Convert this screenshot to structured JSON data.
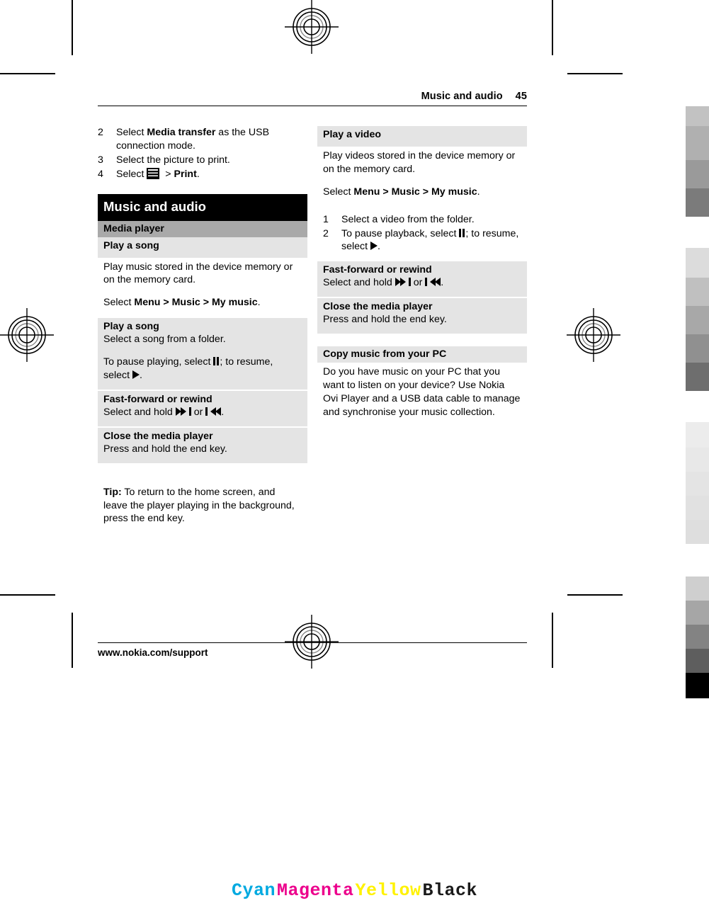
{
  "running_head": {
    "title": "Music and audio",
    "page_number": "45"
  },
  "left_column": {
    "steps": [
      {
        "num": "2",
        "pre": "Select ",
        "bold": "Media transfer",
        "post": " as the USB connection mode."
      },
      {
        "num": "3",
        "pre": "Select the picture to print.",
        "bold": "",
        "post": ""
      },
      {
        "num": "4",
        "pre": "Select ",
        "bold": "",
        "post": ""
      }
    ],
    "step4_suffix_sep": "> ",
    "step4_bold": "Print",
    "step4_end": ".",
    "chapter_title": "Music and audio",
    "section_title": "Media player",
    "intro_task_title": "Play a song",
    "intro_paragraph": "Play music stored in the device memory or on the memory card.",
    "intro_path": {
      "lead": "Select ",
      "b1": "Menu",
      "sep1": " > ",
      "b2": "Music",
      "sep2": " > ",
      "b3": "My music",
      "end": "."
    },
    "tasks": [
      {
        "title": "Play a song",
        "line1": "Select a song from a folder.",
        "line2_a": "To pause playing, select ",
        "line2_icon": "pause-icon",
        "line2_b": "; to resume, select ",
        "line2_icon2": "play-icon",
        "line2_c": "."
      },
      {
        "title": "Fast-forward or rewind",
        "line1_a": "Select and hold ",
        "icon1": "fast-forward-icon",
        "line1_b": " or ",
        "icon2": "rewind-icon",
        "line1_c": "."
      },
      {
        "title": "Close the media player",
        "line1": "Press and hold the end key."
      }
    ],
    "tip": {
      "label": "Tip:",
      "text": " To return to the home screen, and leave the player playing in the background, press the end key."
    }
  },
  "right_column": {
    "video_task": {
      "title": "Play a video",
      "paragraph": "Play videos stored in the device memory or on the memory card.",
      "path": {
        "lead": "Select ",
        "b1": "Menu",
        "sep1": " > ",
        "b2": "Music",
        "sep2": " > ",
        "b3": "My music",
        "end": "."
      }
    },
    "steps": [
      {
        "num": "1",
        "text": "Select a video from the folder."
      },
      {
        "num": "2",
        "pre": "To pause playback, select ",
        "mid": "; to resume, select ",
        "end": "."
      }
    ],
    "tasks": [
      {
        "title": "Fast-forward or rewind",
        "line1_a": "Select and hold ",
        "line1_b": " or ",
        "line1_c": "."
      },
      {
        "title": "Close the media player",
        "line1": "Press and hold the end key."
      },
      {
        "title": "Copy music from your PC",
        "paragraph": "Do you have music on your PC that you want to listen on your device? Use Nokia Ovi Player and a USB data cable to manage and synchronise your music collection."
      }
    ]
  },
  "footer": {
    "url": "www.nokia.com/support"
  },
  "color_bar": {
    "cyan": "Cyan",
    "magenta": "Magenta",
    "yellow": "Yellow",
    "black": "Black",
    "cyan_hex": "#00a9e0",
    "magenta_hex": "#ec008c",
    "yellow_hex": "#fff200",
    "black_hex": "#1a1a1a"
  },
  "press_marks": {
    "registration_target": "registration-target-icon",
    "calibration_strip_label": "grayscale-calibration-strip"
  },
  "palette": {
    "chapter_bar": "#000000",
    "section_bar": "#a9a9a9",
    "task_band": "#e4e4e4",
    "page": "#ffffff"
  }
}
